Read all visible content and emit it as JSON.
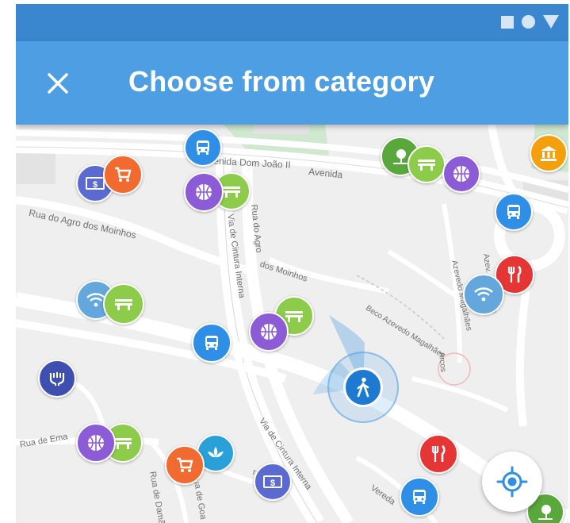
{
  "header": {
    "title": "Choose from category",
    "close_icon": "close-icon"
  },
  "status_bar": {
    "icons": [
      "square-icon",
      "circle-icon",
      "triangle-icon"
    ]
  },
  "map": {
    "street_labels": {
      "dom_joao": "Avenida Dom João II",
      "avenida": "Avenida",
      "agro_moinhos": "Rua do Agro dos Moinhos",
      "via_cintura": "Via de Cintura Interna",
      "agro_vertical": "Rua do Agro",
      "dos_moinhos": "dos Moinhos",
      "azevedo": "Azevedo Magalhães",
      "beco_azevedo": "Beco Azevedo Magalhães",
      "arcos": "Arcos",
      "via_cintura_low": "Via de Cintura Interna",
      "ema": "Rua de Ema",
      "resa": "resa",
      "damao": "Rua de Damão",
      "goa": "Rua de Goa",
      "vereda": "Vereda",
      "azev_right": "Azev. Magalhães"
    },
    "colors": {
      "bus": "#2f8fe6",
      "basketball": "#8b5cd6",
      "bench": "#8ccc4a",
      "shop": "#f16a30",
      "money": "#5b6ad0",
      "wifi": "#64a7dd",
      "food": "#e53535",
      "museum": "#f3a00c",
      "park": "#5aa83c",
      "spa": "#2aa0d8",
      "handshake": "#3e4fb0"
    }
  },
  "location_button": {
    "icon": "gps-target-icon"
  },
  "user_marker": {
    "icon": "pedestrian-icon"
  }
}
